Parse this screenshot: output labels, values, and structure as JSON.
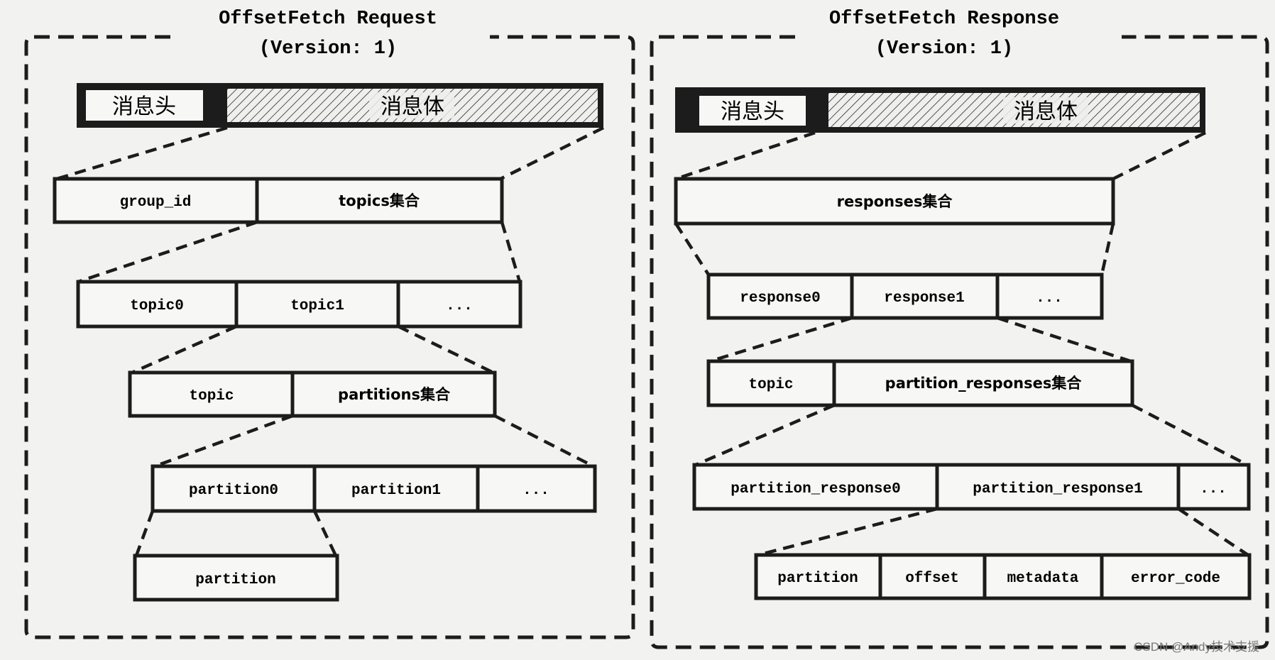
{
  "request": {
    "title": "OffsetFetch Request",
    "version": "(Version: 1)",
    "header": {
      "head": "消息头",
      "body": "消息体"
    },
    "level1": [
      "group_id",
      "topics集合"
    ],
    "level2": [
      "topic0",
      "topic1",
      "..."
    ],
    "level3": [
      "topic",
      "partitions集合"
    ],
    "level4": [
      "partition0",
      "partition1",
      "..."
    ],
    "level5": [
      "partition"
    ]
  },
  "response": {
    "title": "OffsetFetch Response",
    "version": "(Version: 1)",
    "header": {
      "head": "消息头",
      "body": "消息体"
    },
    "level1": [
      "responses集合"
    ],
    "level2": [
      "response0",
      "response1",
      "..."
    ],
    "level3": [
      "topic",
      "partition_responses集合"
    ],
    "level4": [
      "partition_response0",
      "partition_response1",
      "..."
    ],
    "level5": [
      "partition",
      "offset",
      "metadata",
      "error_code"
    ]
  },
  "watermark": "CSDN @Andy技术支援",
  "colors": {
    "ink": "#1c1c1c",
    "background": "#f2f2f0",
    "cell": "#f7f7f5"
  }
}
